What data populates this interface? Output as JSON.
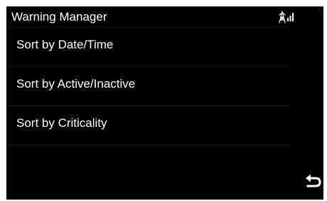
{
  "header": {
    "title": "Warning Manager",
    "status_icon": "antenna-signal-icon"
  },
  "menu": {
    "items": [
      {
        "label": "Sort by Date/Time"
      },
      {
        "label": "Sort by Active/Inactive"
      },
      {
        "label": "Sort by Criticality"
      }
    ]
  },
  "footer": {
    "back_icon": "back-arrow-icon"
  },
  "colors": {
    "background": "#000000",
    "text": "#ffffff",
    "divider": "#161a22"
  }
}
